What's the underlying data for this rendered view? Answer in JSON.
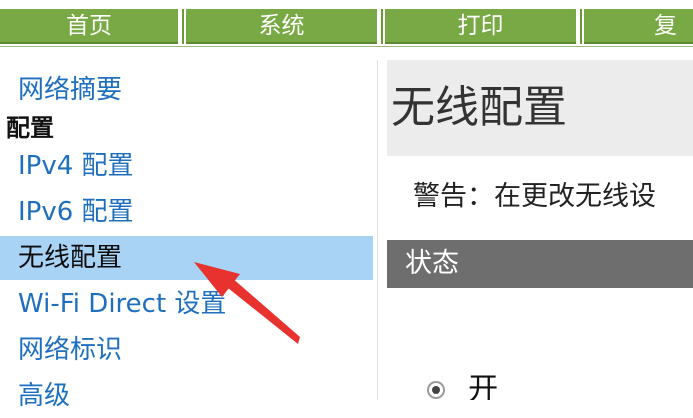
{
  "tabs": [
    {
      "label": "首页"
    },
    {
      "label": "系统"
    },
    {
      "label": "打印"
    },
    {
      "label": "复印"
    }
  ],
  "sidebar": {
    "summary": "网络摘要",
    "heading": "配置",
    "items": [
      {
        "label": "IPv4 配置"
      },
      {
        "label": "IPv6 配置"
      },
      {
        "label": "无线配置"
      },
      {
        "label": "Wi-Fi Direct 设置"
      },
      {
        "label": "网络标识"
      },
      {
        "label": "高级"
      }
    ]
  },
  "content": {
    "title": "无线配置",
    "warning": "警告：在更改无线设",
    "section": "状态",
    "radio_on_label": "开"
  },
  "colors": {
    "tab_green": "#79a944",
    "active_item": "#a9d3f5",
    "section_bar": "#6e6e6e",
    "annotation_arrow": "#e8322f"
  },
  "icons": {
    "annotation": "red-arrow-icon",
    "radio": "radio-selected-icon"
  }
}
